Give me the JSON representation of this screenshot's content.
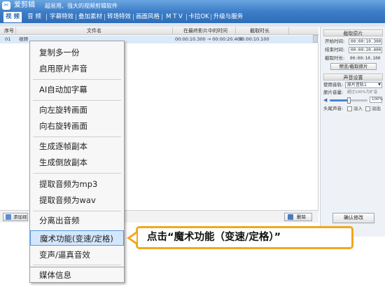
{
  "app": {
    "logo_char": "✂",
    "name": "爱剪辑",
    "subtitle": "超易用、强大的视频剪辑软件"
  },
  "tabs": [
    {
      "label": "视  频",
      "active": true
    },
    {
      "label": "音  频",
      "active": false
    },
    {
      "label": "字幕特效",
      "active": false
    },
    {
      "label": "叠加素材",
      "active": false
    },
    {
      "label": "转场特效",
      "active": false
    },
    {
      "label": "画面风格",
      "active": false
    },
    {
      "label": "M T V",
      "active": false
    },
    {
      "label": "卡拉OK",
      "active": false
    },
    {
      "label": "升级与服务",
      "active": false
    }
  ],
  "table": {
    "headers": {
      "index": "序号",
      "filename": "文件名",
      "time_in_video": "在最终影片中的时间",
      "clip_length": "截取时长"
    },
    "rows": [
      {
        "index": "01",
        "name": "视频",
        "time": "00:00:10.300 → 00:00:20.400",
        "length": "00:00:10.100"
      }
    ]
  },
  "bottom_bar": {
    "add_video_label": "添加视",
    "delete_label": "删除",
    "confirm_label": "确认修改"
  },
  "right_panel": {
    "clip_section": "截取原片",
    "start_label": "开始时间:",
    "start_value": "00:00:10.300",
    "end_label": "结束时间:",
    "end_value": "00:00:20.400",
    "length_label": "截取时长:",
    "length_value": "00:00:10.100",
    "preview_button": "预览/截取原片",
    "audio_section": "声音设置",
    "track_label": "使用音轨:",
    "track_value": "原片音轨1",
    "volume_label": "原片音量:",
    "volume_hint": "超过100%为扩音",
    "volume_value": "100%",
    "volume_level": 0.5,
    "fade_label": "头尾声音:",
    "fade_in": "淡入",
    "fade_out": "淡出"
  },
  "context_menu": {
    "items": [
      {
        "label": "复制多一份"
      },
      {
        "label": "启用原片声音"
      },
      {
        "label": "AI自动加字幕"
      },
      {
        "label": "向左旋转画面"
      },
      {
        "label": "向右旋转画面"
      },
      {
        "label": "生成逐帧副本"
      },
      {
        "label": "生成倒放副本"
      },
      {
        "label": "提取音频为mp3"
      },
      {
        "label": "提取音频为wav"
      },
      {
        "label": "分离出音频"
      },
      {
        "label": "魔术功能(变速/定格)",
        "highlighted": true
      },
      {
        "label": "变声/逼真音效"
      },
      {
        "label": "媒体信息"
      }
    ]
  },
  "callout": {
    "text": "点击“魔术功能（变速/定格）”",
    "color": "#f0a81e"
  },
  "colors": {
    "title_blue": "#3f7fc9",
    "highlight": "#d4e6fb",
    "row_selected": "#dbe9f9"
  }
}
